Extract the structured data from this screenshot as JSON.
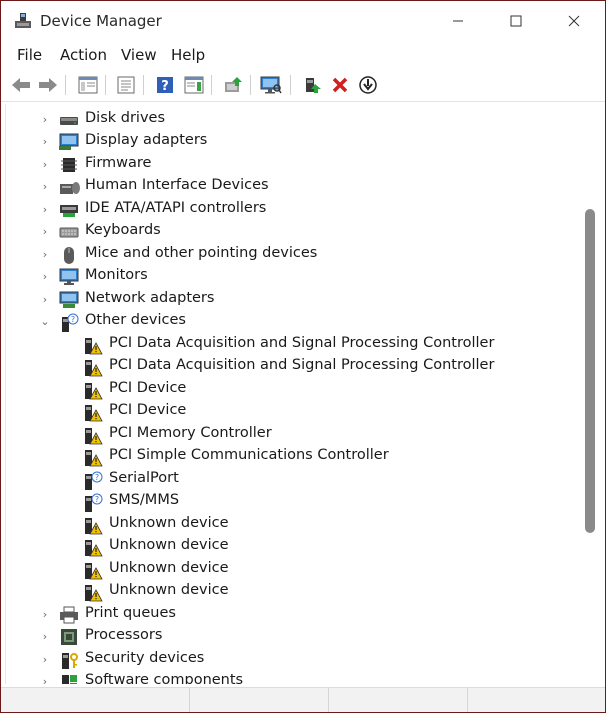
{
  "window": {
    "title": "Device Manager"
  },
  "menu": [
    "File",
    "Action",
    "View",
    "Help"
  ],
  "toolbar": {
    "buttons": [
      "back-arrow-icon",
      "forward-arrow-icon",
      "show-hide-console-tree-icon",
      "properties-icon",
      "help-icon",
      "action-pane-icon",
      "update-driver-icon",
      "scan-hardware-icon",
      "add-legacy-hardware-icon",
      "uninstall-device-icon",
      "disable-device-icon"
    ]
  },
  "tree": {
    "categories_before": [
      {
        "label": "Disk drives",
        "icon": "disk-drive-icon"
      },
      {
        "label": "Display adapters",
        "icon": "display-adapter-icon"
      },
      {
        "label": "Firmware",
        "icon": "firmware-icon"
      },
      {
        "label": "Human Interface Devices",
        "icon": "hid-icon"
      },
      {
        "label": "IDE ATA/ATAPI controllers",
        "icon": "ide-controller-icon"
      },
      {
        "label": "Keyboards",
        "icon": "keyboard-icon"
      },
      {
        "label": "Mice and other pointing devices",
        "icon": "mouse-icon"
      },
      {
        "label": "Monitors",
        "icon": "monitor-icon"
      },
      {
        "label": "Network adapters",
        "icon": "network-adapter-icon"
      }
    ],
    "expanded": {
      "label": "Other devices",
      "icon": "unknown-device-icon"
    },
    "children": [
      {
        "label": "PCI Data Acquisition and Signal Processing Controller",
        "icon": "warning-device-icon"
      },
      {
        "label": "PCI Data Acquisition and Signal Processing Controller",
        "icon": "warning-device-icon"
      },
      {
        "label": "PCI Device",
        "icon": "warning-device-icon"
      },
      {
        "label": "PCI Device",
        "icon": "warning-device-icon"
      },
      {
        "label": "PCI Memory Controller",
        "icon": "warning-device-icon"
      },
      {
        "label": "PCI Simple Communications Controller",
        "icon": "warning-device-icon"
      },
      {
        "label": "SerialPort",
        "icon": "unknown-device-icon"
      },
      {
        "label": "SMS/MMS",
        "icon": "unknown-device-icon"
      },
      {
        "label": "Unknown device",
        "icon": "warning-device-icon"
      },
      {
        "label": "Unknown device",
        "icon": "warning-device-icon"
      },
      {
        "label": "Unknown device",
        "icon": "warning-device-icon"
      },
      {
        "label": "Unknown device",
        "icon": "warning-device-icon"
      }
    ],
    "categories_after": [
      {
        "label": "Print queues",
        "icon": "printer-icon"
      },
      {
        "label": "Processors",
        "icon": "processor-icon"
      },
      {
        "label": "Security devices",
        "icon": "security-device-icon"
      },
      {
        "label": "Software components",
        "icon": "software-component-icon"
      }
    ]
  },
  "colors": {
    "accent": "#1e6fd9",
    "warning": "#f2c200",
    "close": "#d01f1f",
    "update": "#2aa33a"
  }
}
